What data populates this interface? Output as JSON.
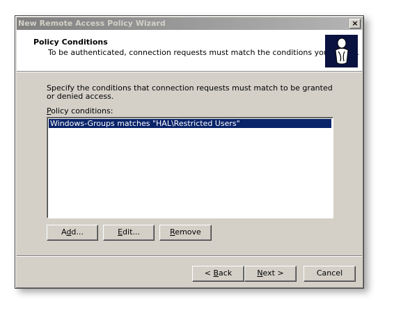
{
  "window": {
    "title": "New Remote Access Policy Wizard",
    "close_label": "×"
  },
  "header": {
    "title": "Policy Conditions",
    "subtitle": "To be authenticated, connection requests must match the conditions you specify.",
    "icon": "wizard-person-icon"
  },
  "body": {
    "instruction": "Specify the conditions that connection requests must match to be granted or denied access.",
    "list_label_prefix": "",
    "list_label_mnemonic": "P",
    "list_label_rest": "olicy conditions:",
    "conditions": [
      "Windows-Groups matches \"HAL\\Restricted Users\""
    ]
  },
  "actions": {
    "add": {
      "pre": "A",
      "mn": "d",
      "post": "d..."
    },
    "edit": {
      "pre": "",
      "mn": "E",
      "post": "dit..."
    },
    "remove": {
      "pre": "",
      "mn": "R",
      "post": "emove"
    }
  },
  "footer": {
    "back": {
      "pre": "< ",
      "mn": "B",
      "post": "ack"
    },
    "next": {
      "pre": "",
      "mn": "N",
      "post": "ext >"
    },
    "cancel": "Cancel"
  },
  "colors": {
    "dialog_bg": "#d4d0c8",
    "selection": "#0a246a",
    "titlebar_inactive": "#808080"
  }
}
